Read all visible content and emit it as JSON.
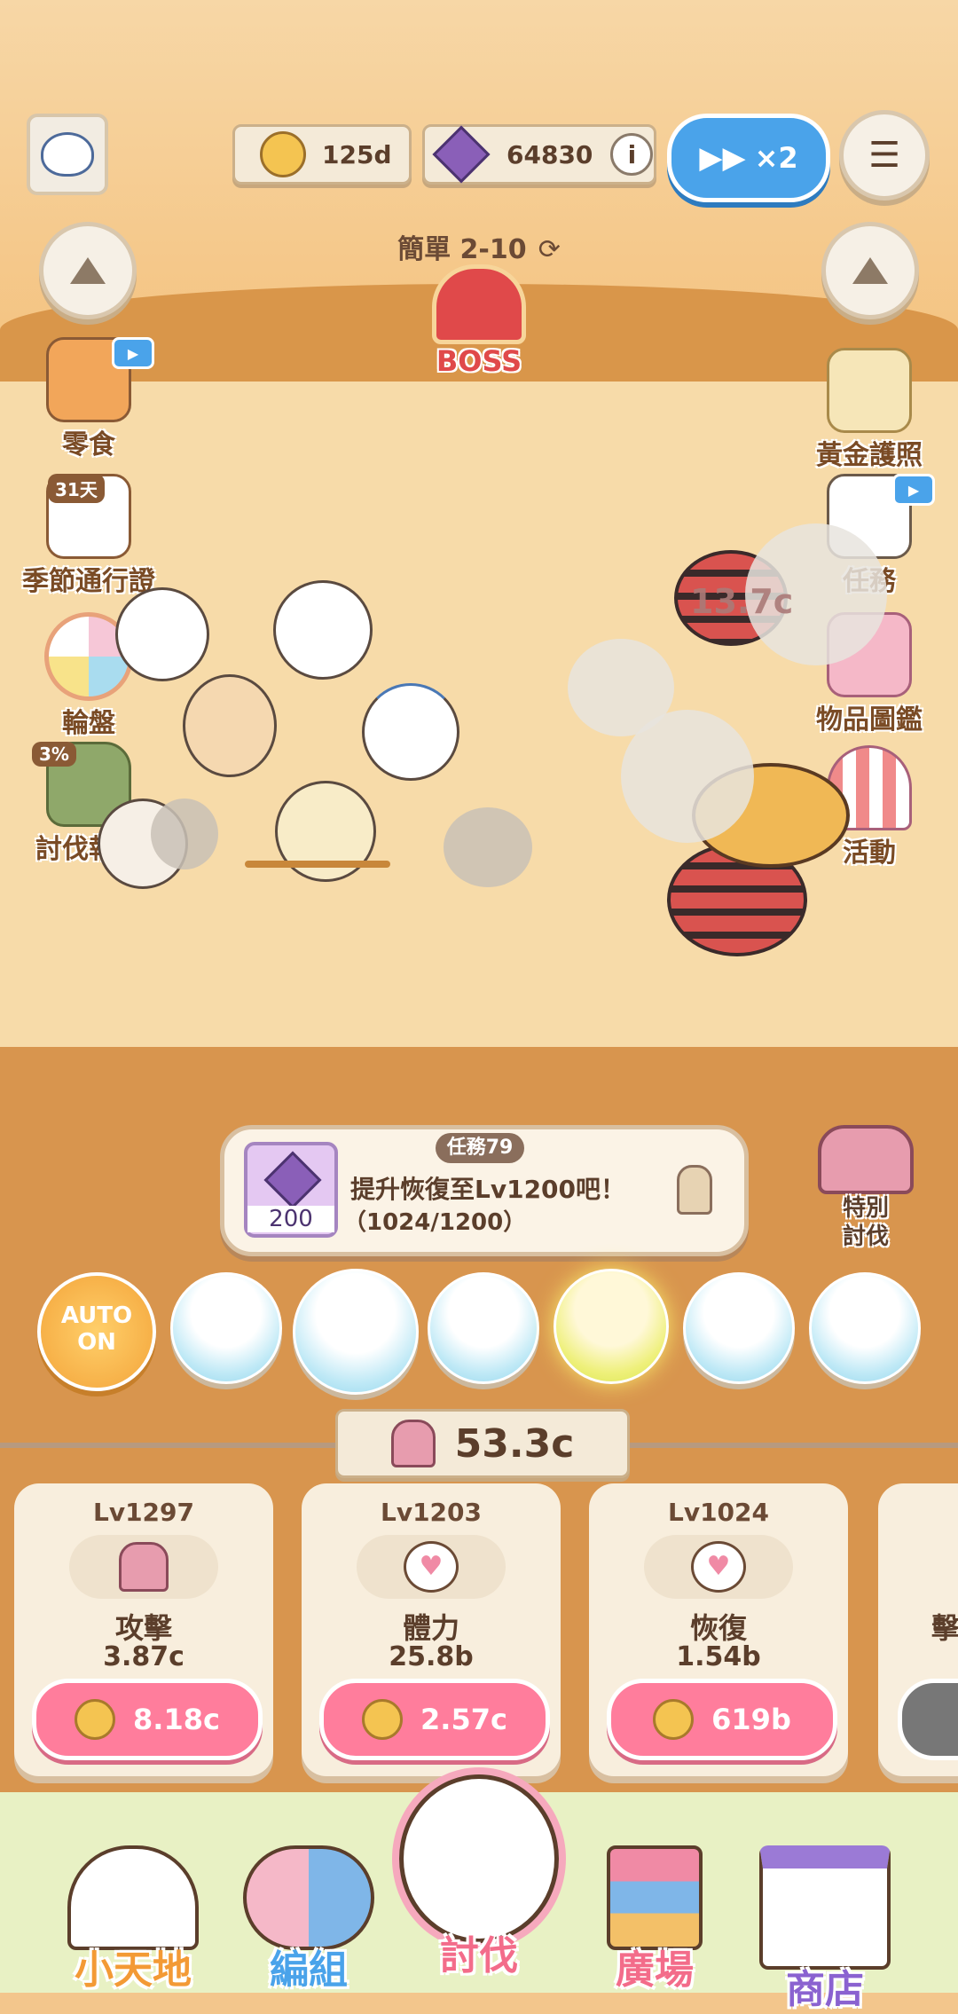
{
  "header": {
    "coins": "125d",
    "gems": "64830",
    "speed": "×2"
  },
  "stage": {
    "name": "簡單 2-10",
    "boss_label": "BOSS"
  },
  "left_menu": [
    {
      "label": "零食",
      "icon": "snack-icon"
    },
    {
      "label": "季節通行證",
      "badge": "31天",
      "icon": "calendar-icon"
    },
    {
      "label": "輪盤",
      "icon": "roulette-icon"
    },
    {
      "label": "討伐報酬",
      "badge": "3%",
      "icon": "reward-bag-icon"
    }
  ],
  "right_menu": [
    {
      "label": "黃金護照",
      "icon": "ticket-icon"
    },
    {
      "label": "任務",
      "icon": "checklist-icon"
    },
    {
      "label": "物品圖鑑",
      "icon": "book-icon"
    },
    {
      "label": "活動",
      "icon": "tent-icon"
    }
  ],
  "battle": {
    "damage": "13.7c"
  },
  "quest": {
    "number": "任務79",
    "reward": "200",
    "text": "提升恢復至Lv1200吧！",
    "progress": "（1024/1200）"
  },
  "special": {
    "label": "特別\n討伐"
  },
  "auto": {
    "line1": "AUTO",
    "line2": "ON"
  },
  "power": "53.3c",
  "upgrades": [
    {
      "level": "Lv1297",
      "name": "攻擊",
      "value": "3.87c",
      "cost": "8.18c",
      "icon": "pitchfork-icon"
    },
    {
      "level": "Lv1203",
      "name": "體力",
      "value": "25.8b",
      "cost": "2.57c",
      "icon": "heart-icon"
    },
    {
      "level": "Lv1024",
      "name": "恢復",
      "value": "1.54b",
      "cost": "619b",
      "icon": "heart-plus-icon"
    },
    {
      "name": "擊"
    }
  ],
  "nav": [
    {
      "label": "小天地",
      "icon": "house-icon"
    },
    {
      "label": "編組",
      "icon": "team-icon"
    },
    {
      "label": "討伐",
      "icon": "battle-icon"
    },
    {
      "label": "廣場",
      "icon": "signpost-icon"
    },
    {
      "label": "商店",
      "icon": "shop-icon"
    }
  ],
  "colors": {
    "accent_pink": "#f36c8a",
    "speed_blue": "#4aa3ea",
    "boss_red": "#e0494a"
  }
}
